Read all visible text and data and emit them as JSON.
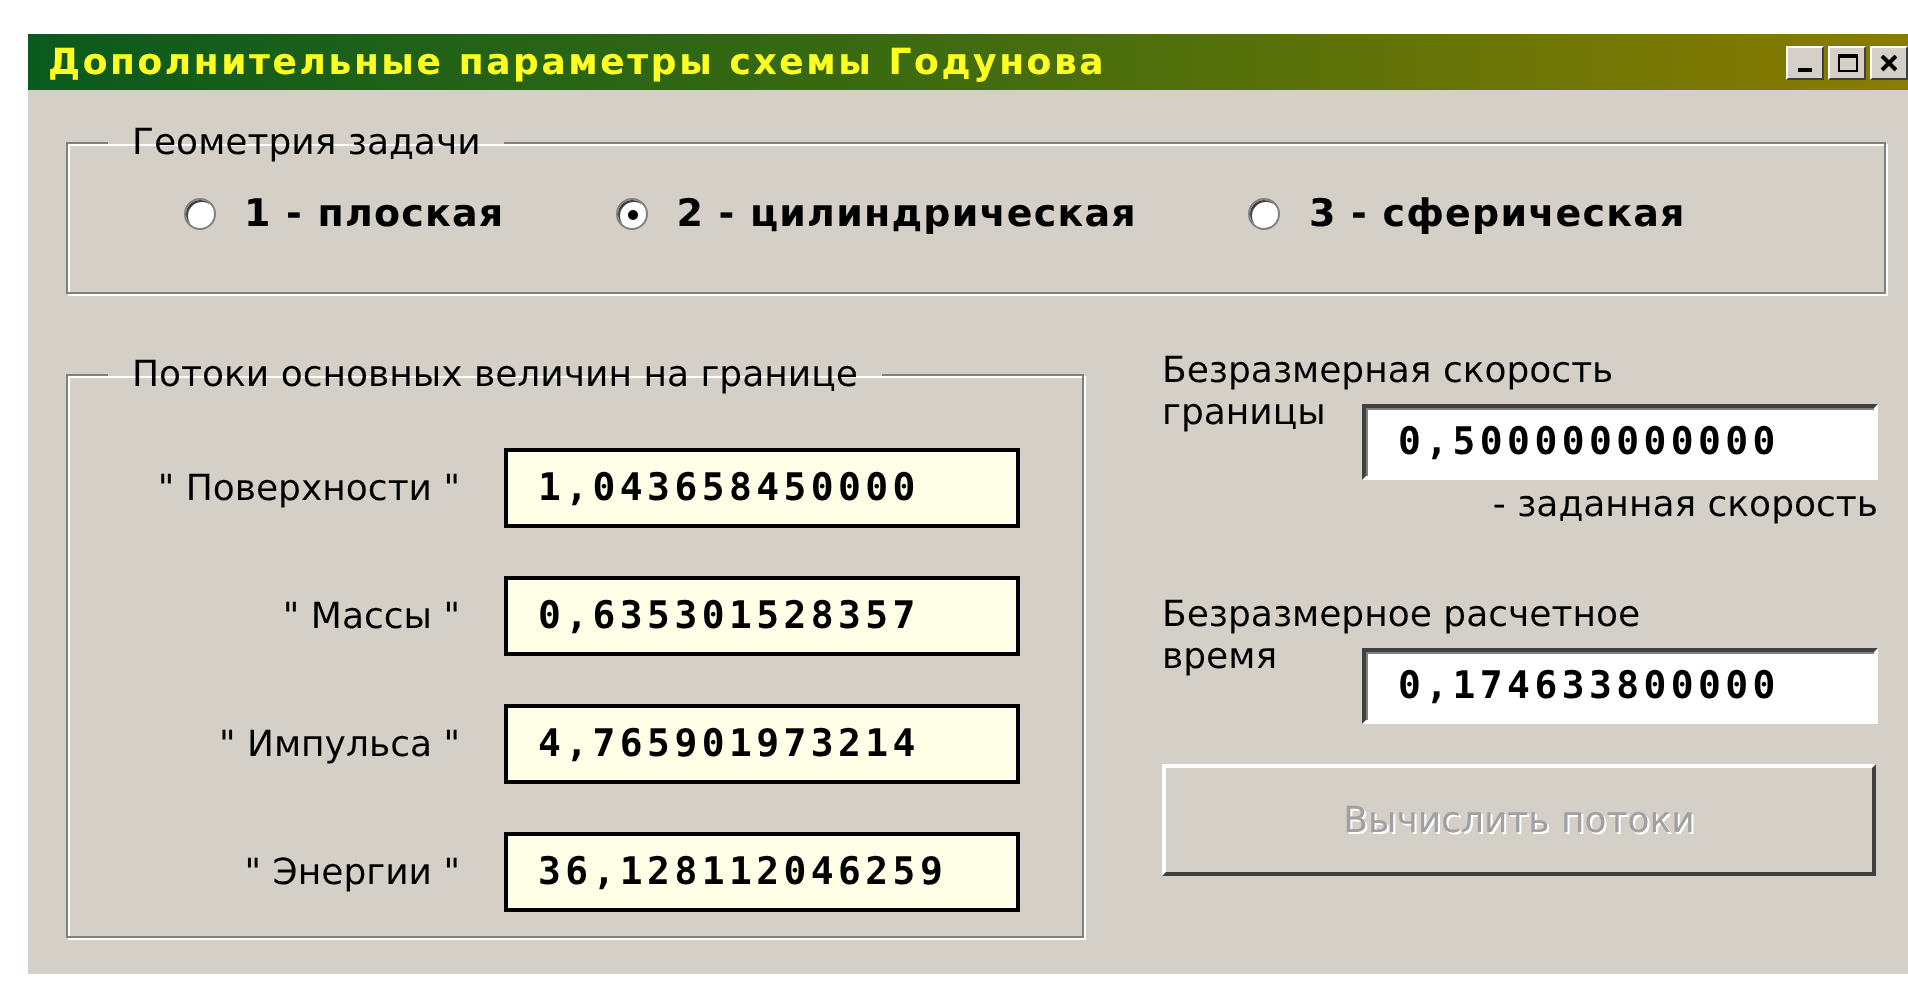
{
  "window": {
    "title": "Дополнительные параметры схемы Годунова",
    "controls": [
      {
        "kind": "minimize"
      },
      {
        "kind": "maximize"
      },
      {
        "kind": "close"
      }
    ]
  },
  "geometry": {
    "title": "Геометрия задачи",
    "options": [
      {
        "label": "1 - плоская",
        "selected": false
      },
      {
        "label": "2 - цилиндрическая",
        "selected": true
      },
      {
        "label": "3 - сферическая",
        "selected": false
      }
    ]
  },
  "fluxes": {
    "title": "Потоки основных величин на границе",
    "rows": [
      {
        "label": "\" Поверхности \"",
        "value": "1,043658450000"
      },
      {
        "label": "\" Массы \"",
        "value": "0,635301528357"
      },
      {
        "label": "\" Импульса \"",
        "value": "4,765901973214"
      },
      {
        "label": "\" Энергии \"",
        "value": "36,128112046259"
      }
    ]
  },
  "params": [
    {
      "label_lines": [
        "Безразмерная скорость",
        "границы"
      ],
      "value": "0,500000000000",
      "note": "- заданная скорость"
    },
    {
      "label_lines": [
        "Безразмерное расчетное",
        "время"
      ],
      "value": "0,174633800000"
    }
  ],
  "button": {
    "label": "Вычислить потоки",
    "disabled": true
  }
}
